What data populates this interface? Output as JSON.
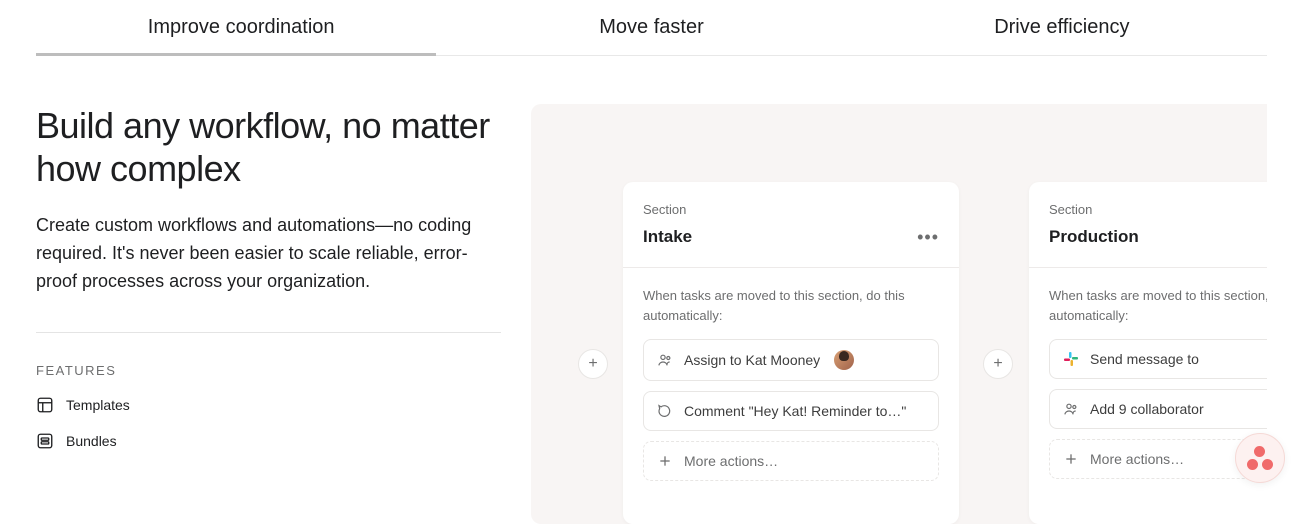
{
  "tabs": {
    "items": [
      {
        "label": "Improve coordination"
      },
      {
        "label": "Move faster"
      },
      {
        "label": "Drive efficiency"
      }
    ]
  },
  "left": {
    "heading": "Build any workflow, no matter how complex",
    "description": "Create custom workflows and automations—no coding required. It's never been easier to scale reliable, error-proof processes across your organization.",
    "features_label": "FEATURES",
    "features": [
      {
        "label": "Templates"
      },
      {
        "label": "Bundles"
      }
    ]
  },
  "workflow": {
    "section_label": "Section",
    "instruction": "When tasks are moved to this section, do this automatically:",
    "more_actions": "More actions…",
    "cards": [
      {
        "title": "Intake",
        "actions": [
          {
            "icon": "people",
            "text": "Assign to Kat Mooney",
            "avatar": true
          },
          {
            "icon": "comment",
            "text": "Comment \"Hey Kat! Reminder to…\""
          }
        ]
      },
      {
        "title": "Production",
        "actions": [
          {
            "icon": "slack",
            "text": "Send message to "
          },
          {
            "icon": "people",
            "text": "Add 9 collaborator"
          }
        ]
      }
    ]
  },
  "plus": "+"
}
